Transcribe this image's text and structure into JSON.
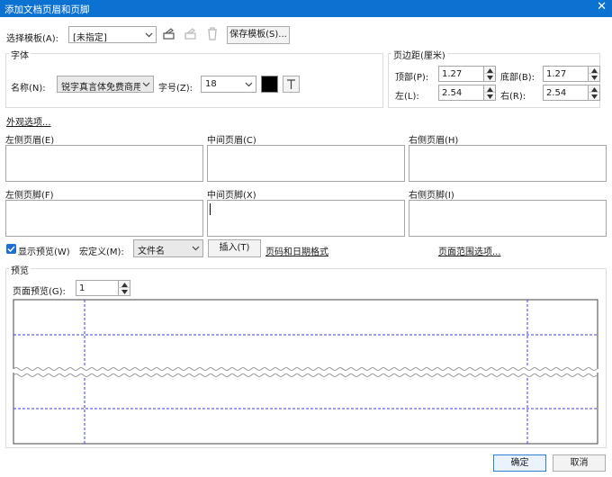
{
  "window": {
    "title": "添加文档页眉和页脚",
    "close_glyph": "✕"
  },
  "template": {
    "label": "选择模板(A):",
    "value": "[未指定]",
    "save_label": "保存模板(S)..."
  },
  "font": {
    "group_title": "字体",
    "name_label": "名称(N):",
    "name_value": "锐字真言体免费商用",
    "size_label": "字号(Z):",
    "size_value": "18",
    "color": "#000000"
  },
  "margins": {
    "group_title": "页边距(厘米)",
    "top_label": "顶部(P):",
    "top_value": "1.27",
    "bottom_label": "底部(B):",
    "bottom_value": "1.27",
    "left_label": "左(L):",
    "left_value": "2.54",
    "right_label": "右(R):",
    "right_value": "2.54"
  },
  "appearance_link": "外观选项...",
  "headers": {
    "left": "左侧页眉(E)",
    "center": "中间页眉(C)",
    "right": "右侧页眉(H)"
  },
  "footers": {
    "left": "左侧页脚(F)",
    "center": "中间页脚(X)",
    "right": "右侧页脚(I)"
  },
  "options": {
    "show_preview_label": "显示预览(W)",
    "show_preview_checked": true,
    "macro_label": "宏定义(M):",
    "macro_value": "文件名",
    "insert_label": "插入(T)",
    "page_number_link": "页码和日期格式",
    "page_range_link": "页面范围选项..."
  },
  "preview": {
    "group_title": "预览",
    "page_label": "页面预览(G):",
    "page_value": "1"
  },
  "buttons": {
    "ok": "确定",
    "cancel": "取消"
  },
  "colors": {
    "titlebar": "#0c72d1",
    "accent": "#1f6fd1",
    "guides": "#3f3fe0"
  }
}
